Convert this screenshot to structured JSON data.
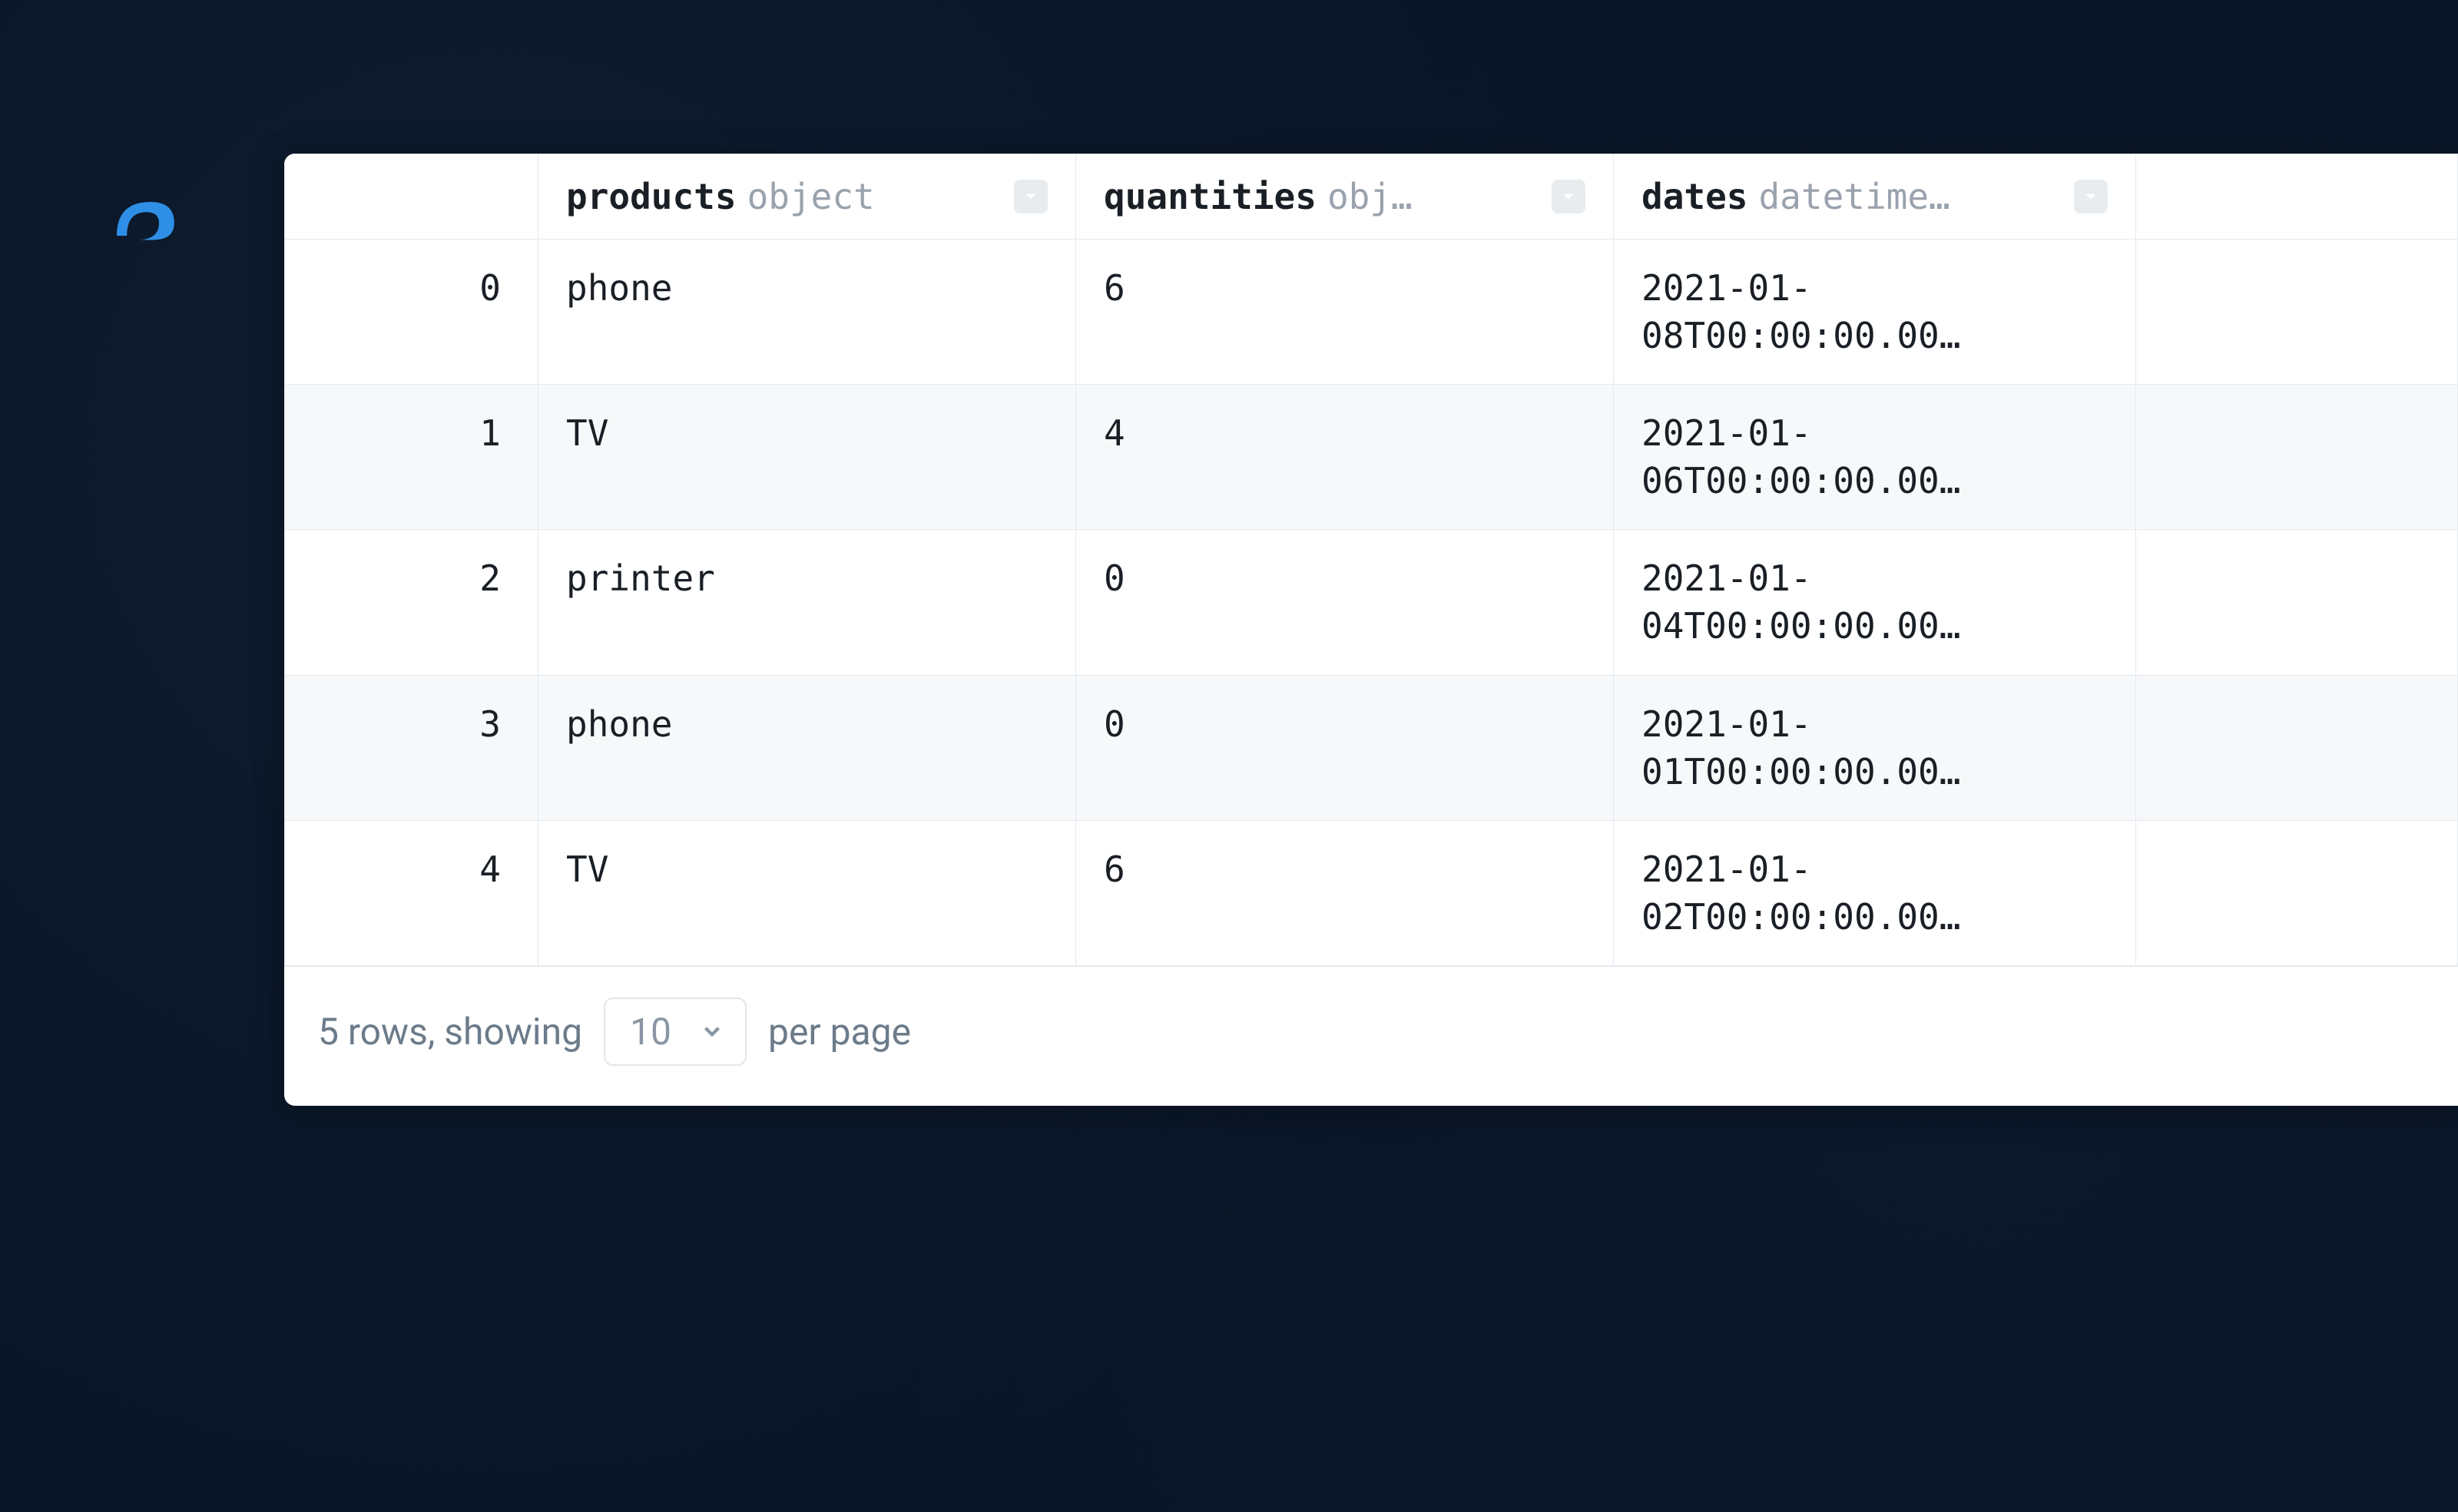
{
  "columns": [
    {
      "name": "products",
      "type": "object"
    },
    {
      "name": "quantities",
      "type": "obj…"
    },
    {
      "name": "dates",
      "type": "datetime…"
    }
  ],
  "rows": [
    {
      "index": "0",
      "products": "phone",
      "quantities": "6",
      "dates": "2021-01-08T00:00:00.00…"
    },
    {
      "index": "1",
      "products": "TV",
      "quantities": "4",
      "dates": "2021-01-06T00:00:00.00…"
    },
    {
      "index": "2",
      "products": "printer",
      "quantities": "0",
      "dates": "2021-01-04T00:00:00.00…"
    },
    {
      "index": "3",
      "products": "phone",
      "quantities": "0",
      "dates": "2021-01-01T00:00:00.00…"
    },
    {
      "index": "4",
      "products": "TV",
      "quantities": "6",
      "dates": "2021-01-02T00:00:00.00…"
    }
  ],
  "footer": {
    "summary_prefix": "5 rows, showing",
    "page_size": "10",
    "summary_suffix": "per page"
  }
}
